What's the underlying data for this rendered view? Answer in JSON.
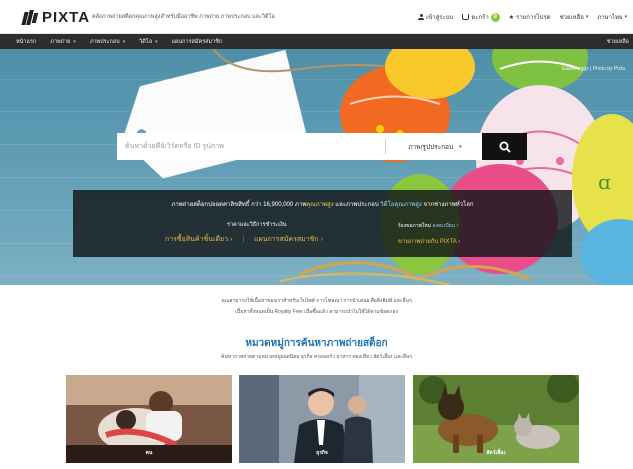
{
  "header": {
    "logo_text": "PIXTA",
    "tagline": "คลังภาพถ่ายสต็อกคุณภาพสูงสำหรับมืออาชีพ ภาพถ่าย ภาพประกอบ และวิดีโอ",
    "links": {
      "login": "เข้าสู่ระบบ",
      "cart": "ตะกร้า",
      "cart_count": "0",
      "favorites": "รายการโปรด",
      "help": "ช่วยเหลือ",
      "lang": "ภาษาไทย"
    }
  },
  "nav": {
    "items": [
      "หน้าแรก",
      "ภาพถ่าย",
      "ภาพประกอบ",
      "วิดีโอ",
      "แผนการสมัครสมาชิก"
    ],
    "right": "ช่วยเหลือ"
  },
  "hero": {
    "credit": "Easter eggs | Photo by Pixta",
    "search": {
      "placeholder": "ค้นหาด้วยคีย์เวิร์ดหรือ ID รูปภาพ",
      "type_label": "ภาพ/รูปประกอบ"
    },
    "promo": {
      "headline_pre": "ภาพถ่ายสต็อกปลอดค่าลิขสิทธิ์ กว่า 16,900,000 ภาพ",
      "headline_hl1": "คุณภาพสูง",
      "headline_mid": " และภาพประกอบ ",
      "headline_hl2": "วิดีโอคุณภาพสูง",
      "headline_post": " จากช่างภาพทั่วโลก",
      "left_label": "ราคาและวิธีการชำระเงิน",
      "left_link1": "การซื้อสินค้าชิ้นเดียว ›",
      "left_link2": "แผนการสมัครสมาชิก ›",
      "right_label": "ร้องขอภาพใหม่ ",
      "right_label_hl": "ลงทะเบียน ›",
      "right_link": "ขายภาพถ่ายกับ PIXTA ›"
    }
  },
  "intro": {
    "line1": "คุณสามารถใช้เนื้อหาของเราสำหรับเว็บไซต์ การโฆษณา การนำเสนอ สื่อสิ่งพิมพ์ และอื่นๆ",
    "line2": "เนื้อหาทั้งหมดเป็น Royalty Free เมื่อซื้อแล้ว สามารถนำไปใช้ได้ตามข้อตกลง"
  },
  "categories": {
    "title": "หมวดหมู่การค้นหาภาพถ่ายสต็อก",
    "subtitle": "ค้นหาภาพถ่ายตามหมวดหมู่ยอดนิยม ธุรกิจ ครอบครัว อาหาร ท่องเที่ยว สัตว์เลี้ยง และอื่นๆ",
    "cards": [
      {
        "label": "คน",
        "color_a": "#6b4b3a",
        "color_b": "#c09a7d"
      },
      {
        "label": "ธุรกิจ",
        "color_a": "#3a4653",
        "color_b": "#9fb0c0"
      },
      {
        "label": "สัตว์เลี้ยง",
        "color_a": "#4b6b2a",
        "color_b": "#a8c07a"
      }
    ]
  },
  "colors": {
    "accent_blue": "#1f73b7",
    "accent_gold": "#e8b94a",
    "nav_bg": "#2d2d2d",
    "cart_badge": "#8cc63f"
  }
}
